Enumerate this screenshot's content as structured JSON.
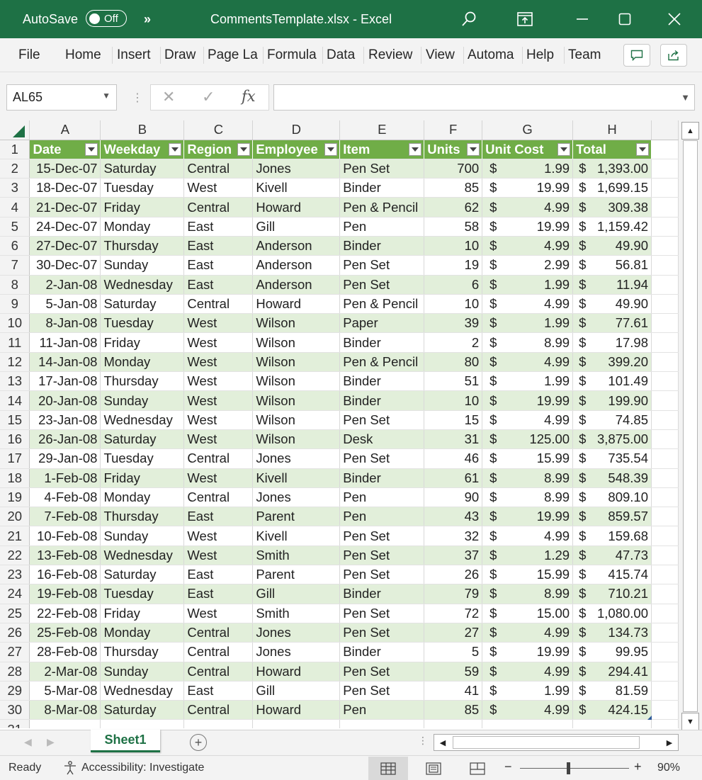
{
  "titlebar": {
    "autosave_label": "AutoSave",
    "toggle_text": "Off",
    "chevrons": "»",
    "document_title": "CommentsTemplate.xlsx  -  Excel"
  },
  "ribbon": {
    "tabs": [
      "File",
      "Home",
      "Insert",
      "Draw",
      "Page La",
      "Formula",
      "Data",
      "Review",
      "View",
      "Automa",
      "Help",
      "Team"
    ]
  },
  "formula_bar": {
    "name_box": "AL65",
    "formula_value": ""
  },
  "grid": {
    "columns": [
      "A",
      "B",
      "C",
      "D",
      "E",
      "F",
      "G",
      "H"
    ],
    "headers": [
      "Date",
      "Weekday",
      "Region",
      "Employee",
      "Item",
      "Units",
      "Unit Cost",
      "Total"
    ],
    "rows": [
      [
        "15-Dec-07",
        "Saturday",
        "Central",
        "Jones",
        "Pen Set",
        "700",
        "1.99",
        "1,393.00"
      ],
      [
        "18-Dec-07",
        "Tuesday",
        "West",
        "Kivell",
        "Binder",
        "85",
        "19.99",
        "1,699.15"
      ],
      [
        "21-Dec-07",
        "Friday",
        "Central",
        "Howard",
        "Pen & Pencil",
        "62",
        "4.99",
        "309.38"
      ],
      [
        "24-Dec-07",
        "Monday",
        "East",
        "Gill",
        "Pen",
        "58",
        "19.99",
        "1,159.42"
      ],
      [
        "27-Dec-07",
        "Thursday",
        "East",
        "Anderson",
        "Binder",
        "10",
        "4.99",
        "49.90"
      ],
      [
        "30-Dec-07",
        "Sunday",
        "East",
        "Anderson",
        "Pen Set",
        "19",
        "2.99",
        "56.81"
      ],
      [
        "2-Jan-08",
        "Wednesday",
        "East",
        "Anderson",
        "Pen Set",
        "6",
        "1.99",
        "11.94"
      ],
      [
        "5-Jan-08",
        "Saturday",
        "Central",
        "Howard",
        "Pen & Pencil",
        "10",
        "4.99",
        "49.90"
      ],
      [
        "8-Jan-08",
        "Tuesday",
        "West",
        "Wilson",
        "Paper",
        "39",
        "1.99",
        "77.61"
      ],
      [
        "11-Jan-08",
        "Friday",
        "West",
        "Wilson",
        "Binder",
        "2",
        "8.99",
        "17.98"
      ],
      [
        "14-Jan-08",
        "Monday",
        "West",
        "Wilson",
        "Pen & Pencil",
        "80",
        "4.99",
        "399.20"
      ],
      [
        "17-Jan-08",
        "Thursday",
        "West",
        "Wilson",
        "Binder",
        "51",
        "1.99",
        "101.49"
      ],
      [
        "20-Jan-08",
        "Sunday",
        "West",
        "Wilson",
        "Binder",
        "10",
        "19.99",
        "199.90"
      ],
      [
        "23-Jan-08",
        "Wednesday",
        "West",
        "Wilson",
        "Pen Set",
        "15",
        "4.99",
        "74.85"
      ],
      [
        "26-Jan-08",
        "Saturday",
        "West",
        "Wilson",
        "Desk",
        "31",
        "125.00",
        "3,875.00"
      ],
      [
        "29-Jan-08",
        "Tuesday",
        "Central",
        "Jones",
        "Pen Set",
        "46",
        "15.99",
        "735.54"
      ],
      [
        "1-Feb-08",
        "Friday",
        "West",
        "Kivell",
        "Binder",
        "61",
        "8.99",
        "548.39"
      ],
      [
        "4-Feb-08",
        "Monday",
        "Central",
        "Jones",
        "Pen",
        "90",
        "8.99",
        "809.10"
      ],
      [
        "7-Feb-08",
        "Thursday",
        "East",
        "Parent",
        "Pen",
        "43",
        "19.99",
        "859.57"
      ],
      [
        "10-Feb-08",
        "Sunday",
        "West",
        "Kivell",
        "Pen Set",
        "32",
        "4.99",
        "159.68"
      ],
      [
        "13-Feb-08",
        "Wednesday",
        "West",
        "Smith",
        "Pen Set",
        "37",
        "1.29",
        "47.73"
      ],
      [
        "16-Feb-08",
        "Saturday",
        "East",
        "Parent",
        "Pen Set",
        "26",
        "15.99",
        "415.74"
      ],
      [
        "19-Feb-08",
        "Tuesday",
        "East",
        "Gill",
        "Binder",
        "79",
        "8.99",
        "710.21"
      ],
      [
        "22-Feb-08",
        "Friday",
        "West",
        "Smith",
        "Pen Set",
        "72",
        "15.00",
        "1,080.00"
      ],
      [
        "25-Feb-08",
        "Monday",
        "Central",
        "Jones",
        "Pen Set",
        "27",
        "4.99",
        "134.73"
      ],
      [
        "28-Feb-08",
        "Thursday",
        "Central",
        "Jones",
        "Binder",
        "5",
        "19.99",
        "99.95"
      ],
      [
        "2-Mar-08",
        "Sunday",
        "Central",
        "Howard",
        "Pen Set",
        "59",
        "4.99",
        "294.41"
      ],
      [
        "5-Mar-08",
        "Wednesday",
        "East",
        "Gill",
        "Pen Set",
        "41",
        "1.99",
        "81.59"
      ],
      [
        "8-Mar-08",
        "Saturday",
        "Central",
        "Howard",
        "Pen",
        "85",
        "4.99",
        "424.15"
      ]
    ],
    "currency_symbol": "$"
  },
  "sheets": {
    "active": "Sheet1"
  },
  "statusbar": {
    "ready": "Ready",
    "accessibility": "Accessibility: Investigate",
    "zoom_minus": "−",
    "zoom_plus": "+",
    "zoom": "90%"
  },
  "colors": {
    "excel_green": "#1e7145",
    "table_header": "#70ad47",
    "band_row": "#e2efda"
  },
  "icons": [
    "search-icon",
    "restore-icon",
    "minimize-icon",
    "maximize-icon",
    "close-icon",
    "comments-icon",
    "share-icon",
    "cancel-icon",
    "enter-icon",
    "function-icon",
    "normal-view-icon",
    "page-layout-icon",
    "page-break-icon",
    "accessibility-icon"
  ]
}
